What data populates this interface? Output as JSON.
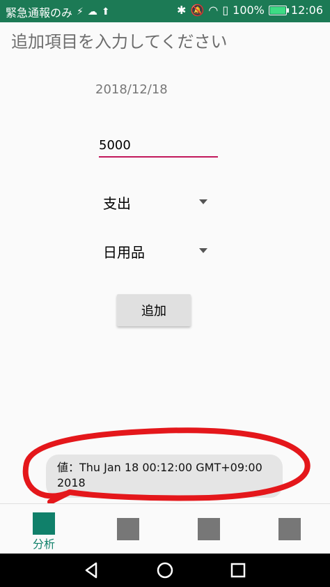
{
  "status_bar": {
    "left_text": "緊急通報のみ",
    "time": "12:06",
    "battery": "100%",
    "battery_level": 1.0,
    "icons": [
      "usb-icon",
      "cloud-icon",
      "download-icon",
      "bluetooth-icon",
      "mute-icon",
      "wifi-icon",
      "sim-icon",
      "battery-icon"
    ]
  },
  "header": {
    "title": "追加項目を入力してください"
  },
  "form": {
    "date": "2018/12/18",
    "amount": "5000",
    "type_selected": "支出",
    "category_selected": "日用品",
    "add_label": "追加"
  },
  "toast": {
    "line1": "値：Thu Jan 18 00:12:00 GMT+09:00",
    "line2": "2018"
  },
  "bottom_nav": {
    "items": [
      {
        "label": "分析",
        "active": true
      },
      {
        "label": "",
        "active": false
      },
      {
        "label": "",
        "active": false
      },
      {
        "label": "",
        "active": false
      }
    ]
  },
  "colors": {
    "status_bar": "#1c7a55",
    "accent": "#10806a",
    "input_underline": "#c2185b",
    "annotation": "#e4171b"
  }
}
